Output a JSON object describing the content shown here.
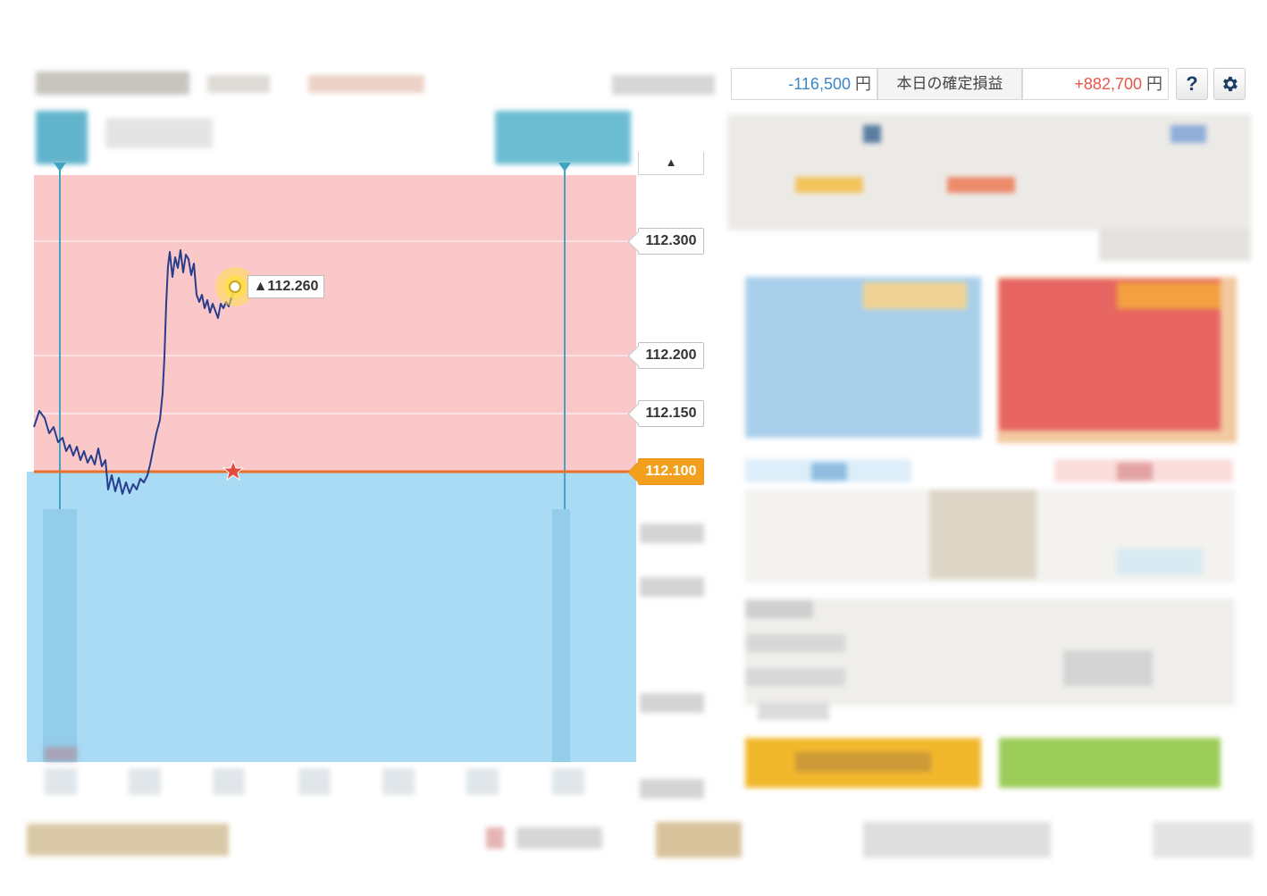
{
  "header": {
    "unrealized_pl": "-116,500",
    "unrealized_unit": "円",
    "confirmed_label": "本日の確定損益",
    "confirmed_pl": "+882,700",
    "confirmed_unit": "円",
    "help_icon": "?",
    "settings_icon": "gear-icon"
  },
  "chart": {
    "target_label": "▲112.260",
    "price_levels": [
      "112.300",
      "112.200",
      "112.150",
      "112.100"
    ],
    "scroll_up_icon": "▲",
    "colors": {
      "above": "#fbc8c9",
      "below": "#a9dbf5",
      "current_line": "#e9702a",
      "price_line": "#283e8c",
      "current_tag": "#f2a01e"
    }
  },
  "colors": {
    "profit": "#e8564a",
    "loss": "#3b87c9",
    "accent": "#1d3e66"
  }
}
